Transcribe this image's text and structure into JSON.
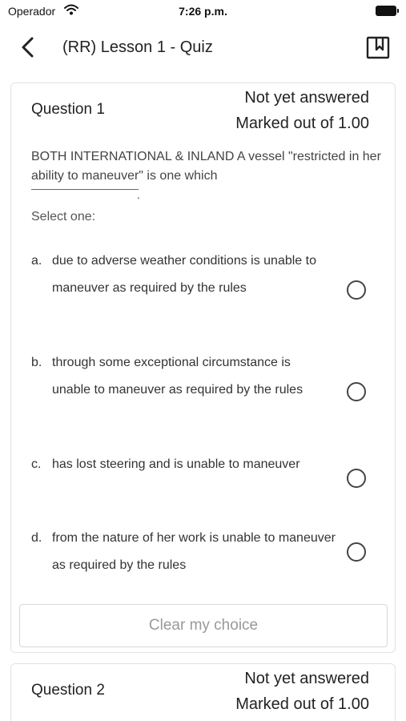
{
  "status_bar": {
    "carrier": "Operador",
    "time": "7:26 p.m.",
    "icons": [
      "wifi-icon",
      "battery-icon"
    ]
  },
  "nav": {
    "title": "(RR) Lesson 1 - Quiz",
    "back_icon": "chevron-left-icon",
    "bookmark_icon": "bookmark-icon"
  },
  "questions": [
    {
      "label": "Question 1",
      "status": "Not yet answered",
      "marks": "Marked out of 1.00",
      "text": "BOTH INTERNATIONAL & INLAND A vessel \"restricted in her ability to maneuver\" is one which",
      "blank_suffix": ".",
      "select_label": "Select one:",
      "options": [
        {
          "letter": "a.",
          "text": "due to adverse weather conditions is unable to maneuver as required by the rules",
          "selected": false
        },
        {
          "letter": "b.",
          "text": "through some exceptional circumstance is unable to maneuver as required by the rules",
          "selected": false
        },
        {
          "letter": "c.",
          "text": "has lost steering and is unable to maneuver",
          "selected": false
        },
        {
          "letter": "d.",
          "text": "from the nature of her work is unable to maneuver as required by the rules",
          "selected": false
        }
      ],
      "clear_label": "Clear my choice"
    },
    {
      "label": "Question 2",
      "status": "Not yet answered",
      "marks": "Marked out of 1.00"
    }
  ]
}
